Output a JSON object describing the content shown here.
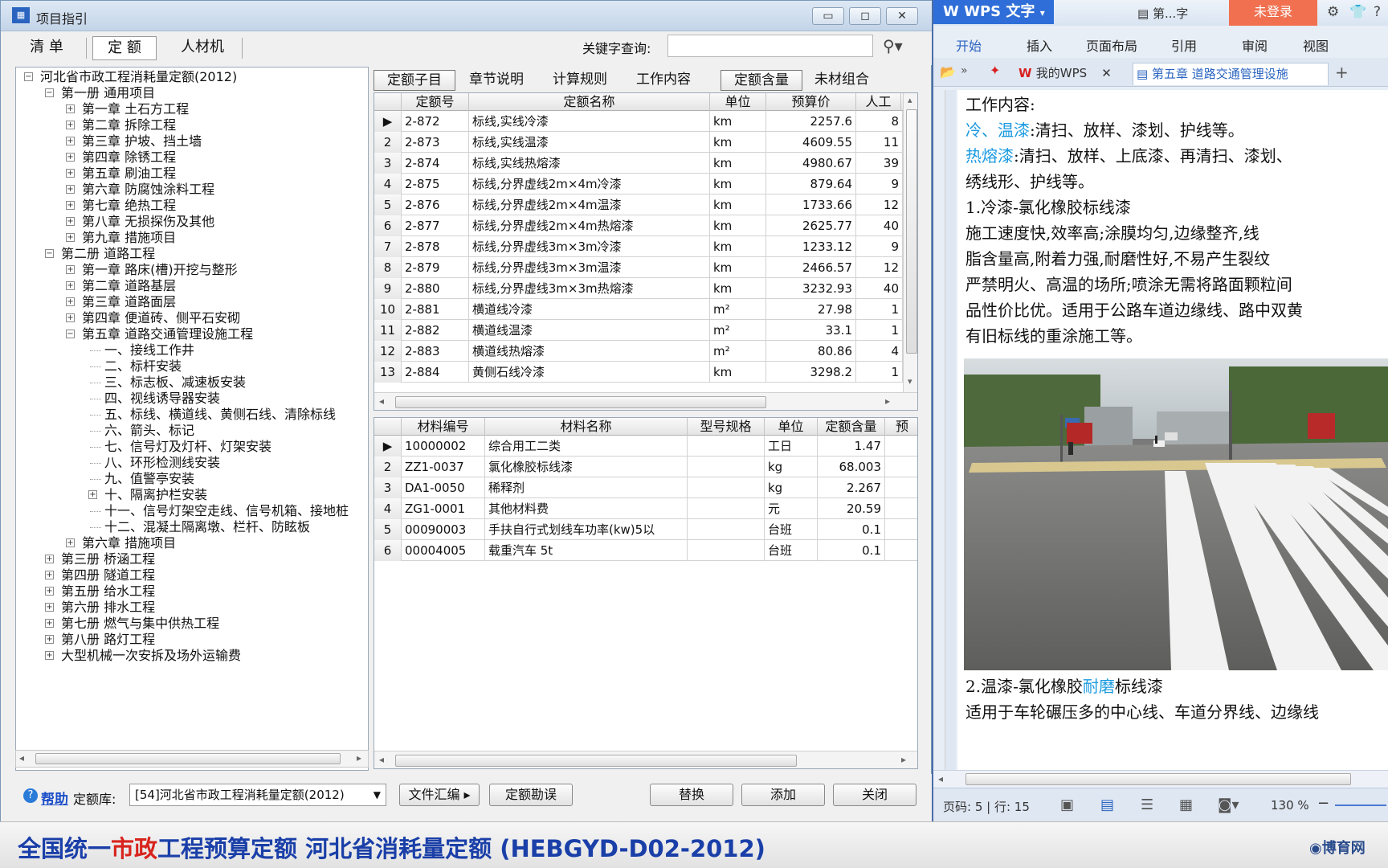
{
  "window": {
    "title": "项目指引"
  },
  "toolbar": {
    "tabs": [
      "清 单",
      "定 额",
      "人材机"
    ],
    "keyword_label": "关键字查询:",
    "keyword_value": ""
  },
  "tree": {
    "root": "河北省市政工程消耗量定额(2012)",
    "book1": "第一册 通用项目",
    "book1_chapters": [
      "第一章 土石方工程",
      "第二章 拆除工程",
      "第三章 护坡、挡土墙",
      "第四章 除锈工程",
      "第五章 刷油工程",
      "第六章 防腐蚀涂料工程",
      "第七章 绝热工程",
      "第八章 无损探伤及其他",
      "第九章 措施项目"
    ],
    "book2": "第二册 道路工程",
    "book2_chapters": [
      "第一章 路床(槽)开挖与整形",
      "第二章 道路基层",
      "第三章 道路面层",
      "第四章 便道砖、侧平石安砌",
      "第五章 道路交通管理设施工程"
    ],
    "ch5_items": [
      "一、接线工作井",
      "二、标杆安装",
      "三、标志板、减速板安装",
      "四、视线诱导器安装",
      "五、标线、横道线、黄侧石线、清除标线",
      "六、箭头、标记",
      "七、信号灯及灯杆、灯架安装",
      "八、环形检测线安装",
      "九、值警亭安装",
      "十、隔离护栏安装",
      "十一、信号灯架空走线、信号机箱、接地桩",
      "十二、混凝土隔离墩、栏杆、防眩板"
    ],
    "book2_ch6": "第六章 措施项目",
    "other_books": [
      "第三册 桥涵工程",
      "第四册 隧道工程",
      "第五册 给水工程",
      "第六册 排水工程",
      "第七册 燃气与集中供热工程",
      "第八册 路灯工程",
      "大型机械一次安拆及场外运输费"
    ]
  },
  "right_tabs": [
    "定额子目",
    "章节说明",
    "计算规则",
    "工作内容",
    "定额含量",
    "未材组合"
  ],
  "quota_grid": {
    "headers": [
      "定额号",
      "定额名称",
      "单位",
      "预算价",
      "人工"
    ],
    "rows": [
      {
        "idx": "",
        "code": "2-872",
        "name": "标线,实线冷漆",
        "unit": "km",
        "price": "2257.6",
        "labor": "8"
      },
      {
        "idx": "2",
        "code": "2-873",
        "name": "标线,实线温漆",
        "unit": "km",
        "price": "4609.55",
        "labor": "11"
      },
      {
        "idx": "3",
        "code": "2-874",
        "name": "标线,实线热熔漆",
        "unit": "km",
        "price": "4980.67",
        "labor": "39"
      },
      {
        "idx": "4",
        "code": "2-875",
        "name": "标线,分界虚线2m×4m冷漆",
        "unit": "km",
        "price": "879.64",
        "labor": "9"
      },
      {
        "idx": "5",
        "code": "2-876",
        "name": "标线,分界虚线2m×4m温漆",
        "unit": "km",
        "price": "1733.66",
        "labor": "12"
      },
      {
        "idx": "6",
        "code": "2-877",
        "name": "标线,分界虚线2m×4m热熔漆",
        "unit": "km",
        "price": "2625.77",
        "labor": "40"
      },
      {
        "idx": "7",
        "code": "2-878",
        "name": "标线,分界虚线3m×3m冷漆",
        "unit": "km",
        "price": "1233.12",
        "labor": "9"
      },
      {
        "idx": "8",
        "code": "2-879",
        "name": "标线,分界虚线3m×3m温漆",
        "unit": "km",
        "price": "2466.57",
        "labor": "12"
      },
      {
        "idx": "9",
        "code": "2-880",
        "name": "标线,分界虚线3m×3m热熔漆",
        "unit": "km",
        "price": "3232.93",
        "labor": "40"
      },
      {
        "idx": "10",
        "code": "2-881",
        "name": "横道线冷漆",
        "unit": "m²",
        "price": "27.98",
        "labor": "1"
      },
      {
        "idx": "11",
        "code": "2-882",
        "name": "横道线温漆",
        "unit": "m²",
        "price": "33.1",
        "labor": "1"
      },
      {
        "idx": "12",
        "code": "2-883",
        "name": "横道线热熔漆",
        "unit": "m²",
        "price": "80.86",
        "labor": "4"
      },
      {
        "idx": "13",
        "code": "2-884",
        "name": "黄侧石线冷漆",
        "unit": "km",
        "price": "3298.2",
        "labor": "1"
      }
    ]
  },
  "material_grid": {
    "headers": [
      "材料编号",
      "材料名称",
      "型号规格",
      "单位",
      "定额含量",
      "预"
    ],
    "rows": [
      {
        "idx": "",
        "code": "10000002",
        "name": "综合用工二类",
        "spec": "",
        "unit": "工日",
        "qty": "1.47"
      },
      {
        "idx": "2",
        "code": "ZZ1-0037",
        "name": "氯化橡胶标线漆",
        "spec": "",
        "unit": "kg",
        "qty": "68.003"
      },
      {
        "idx": "3",
        "code": "DA1-0050",
        "name": "稀释剂",
        "spec": "",
        "unit": "kg",
        "qty": "2.267"
      },
      {
        "idx": "4",
        "code": "ZG1-0001",
        "name": "其他材料费",
        "spec": "",
        "unit": "元",
        "qty": "20.59"
      },
      {
        "idx": "5",
        "code": "00090003",
        "name": "手扶自行式划线车功率(kw)5以",
        "spec": "",
        "unit": "台班",
        "qty": "0.1"
      },
      {
        "idx": "6",
        "code": "00004005",
        "name": "载重汽车 5t",
        "spec": "",
        "unit": "台班",
        "qty": "0.1"
      }
    ]
  },
  "bottom": {
    "help": "帮助",
    "lib_label": "定额库:",
    "lib_value": "[54]河北省市政工程消耗量定额(2012)",
    "buttons": [
      "文件汇编 ▸",
      "定额勘误",
      "替换",
      "添加",
      "关闭"
    ]
  },
  "wps": {
    "app": "WPS 文字",
    "doc_short": "第...字",
    "login": "未登录",
    "menus": [
      "开始",
      "插入",
      "页面布局",
      "引用",
      "审阅",
      "视图"
    ],
    "tabs": [
      "我的WPS",
      "第五章 道路交通管理设施"
    ],
    "status_page": "页码: 5 | 行: 15",
    "zoom": "130 %",
    "lines": {
      "l1": "工作内容:",
      "l2a": "冷、温漆",
      "l2b": ":清扫、放样、漆划、护线等。",
      "l3a": "热熔漆",
      "l3b": ":清扫、放样、上底漆、再清扫、漆划、",
      "l4": "绣线形、护线等。",
      "l5": "1.冷漆-氯化橡胶标线漆",
      "l6": "施工速度快,效率高;涂膜均匀,边缘整齐,线",
      "l7": "脂含量高,附着力强,耐磨性好,不易产生裂纹",
      "l8": "严禁明火、高温的场所;喷涂无需将路面颗粒间",
      "l9": "品性价比优。适用于公路车道边缘线、路中双黄",
      "l10": "有旧标线的重涂施工等。",
      "l11a": "2.温漆-氯化橡胶",
      "l11b": "耐磨",
      "l11c": "标线漆",
      "l12": "适用于车轮碾压多的中心线、车道分界线、边缘线"
    }
  },
  "subtitle": {
    "part1": "全国统一",
    "part2": "市政",
    "part3": "工程预算定额 河北省消耗量定额 (HEBGYD-D02-2012)",
    "logo": "博育网"
  }
}
